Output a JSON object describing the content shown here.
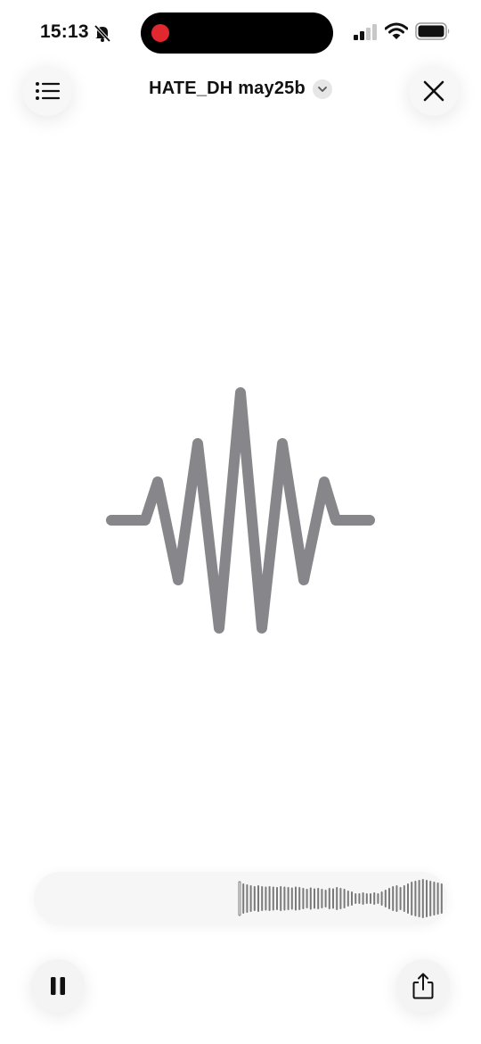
{
  "status_bar": {
    "time": "15:13",
    "icons": [
      "bell-slash-icon",
      "recording-indicator",
      "cellular-signal-icon",
      "wifi-icon",
      "battery-icon"
    ],
    "recording_color": "#e0282e"
  },
  "header": {
    "title": "HATE_DH may25b",
    "left_button_icon": "list-icon",
    "right_button_icon": "close-icon",
    "title_chevron_icon": "chevron-down-icon"
  },
  "main": {
    "visual_icon": "waveform-icon",
    "icon_color": "#86868b"
  },
  "scrubber": {
    "playback_icon": "audio-waveform-scrubber"
  },
  "controls": {
    "play_state_icon": "pause-icon",
    "share_icon": "share-icon"
  }
}
